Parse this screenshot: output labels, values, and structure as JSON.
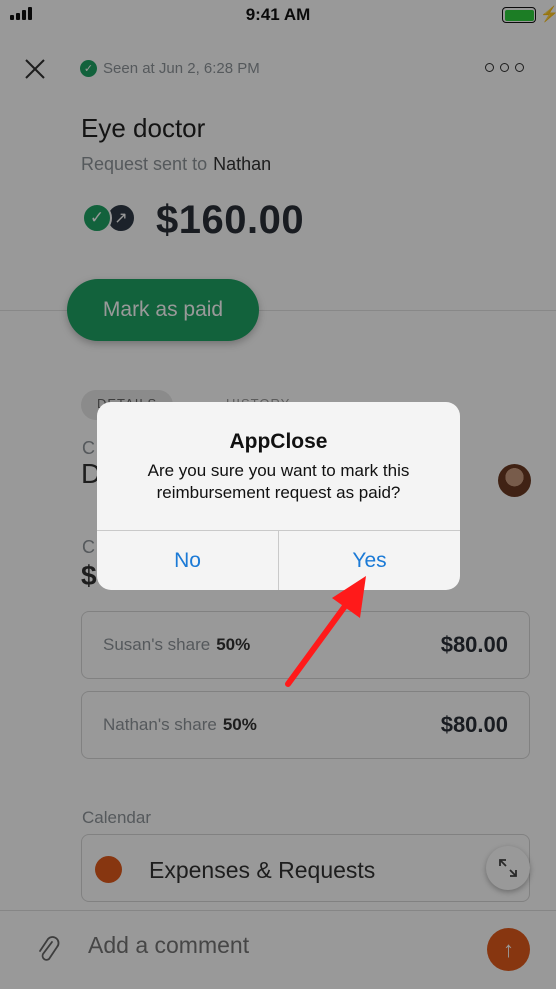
{
  "status_bar": {
    "time": "9:41 AM"
  },
  "header": {
    "seen_text": "Seen at Jun 2, 6:28 PM"
  },
  "request": {
    "title": "Eye doctor",
    "sent_label": "Request sent to",
    "recipient": "Nathan",
    "amount": "$160.00",
    "mark_paid_label": "Mark as paid"
  },
  "tabs": {
    "details": "DETAILS",
    "history": "HISTORY"
  },
  "partial": {
    "c1": "C",
    "d": "D",
    "c2": "C",
    "s": "$"
  },
  "shares": [
    {
      "label": "Susan's share",
      "percent": "50%",
      "amount": "$80.00"
    },
    {
      "label": "Nathan's share",
      "percent": "50%",
      "amount": "$80.00"
    }
  ],
  "calendar": {
    "label": "Calendar",
    "name": "Expenses & Requests",
    "color": "#e15a1c"
  },
  "comment": {
    "placeholder": "Add a comment"
  },
  "dialog": {
    "title": "AppClose",
    "message": "Are you sure you want to mark this reimbursement request as paid?",
    "no_label": "No",
    "yes_label": "Yes"
  },
  "colors": {
    "accent": "#1ea364",
    "link": "#1b7ad6",
    "arrow": "#ff1a1a"
  }
}
